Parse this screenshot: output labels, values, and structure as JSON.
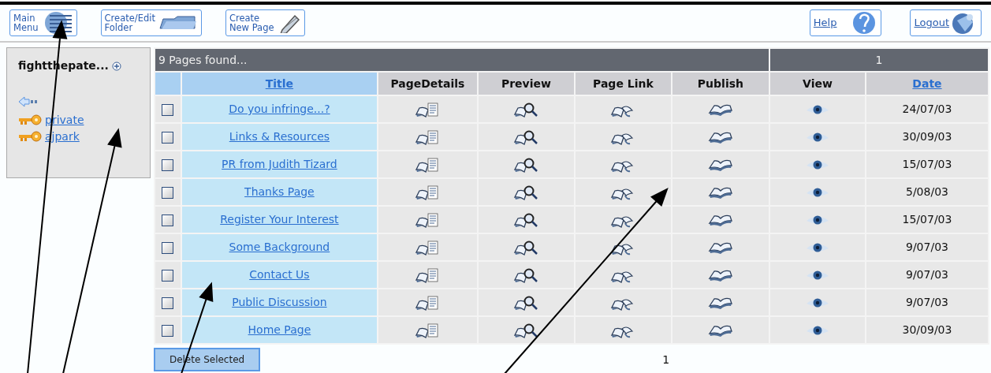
{
  "toolbar": [
    {
      "kind": "menu",
      "label_lines": [
        "Main",
        "Menu"
      ]
    },
    {
      "kind": "folder",
      "label_lines": [
        "Create/Edit",
        "Folder"
      ]
    },
    {
      "kind": "new_page",
      "label_lines": [
        "Create",
        "New Page"
      ]
    }
  ],
  "toolbar_right": [
    {
      "kind": "help",
      "label": "Help"
    },
    {
      "kind": "logout",
      "label": "Logout"
    }
  ],
  "sidebar": {
    "title": "fightthepate...",
    "items": [
      {
        "kind": "key",
        "label": "private"
      },
      {
        "kind": "key",
        "label": "ajpark"
      }
    ]
  },
  "table": {
    "summary": "9 Pages found...",
    "page_number": "1",
    "columns": [
      {
        "label": "Title",
        "sortable": true
      },
      {
        "label": "PageDetails",
        "sortable": false
      },
      {
        "label": "Preview",
        "sortable": false
      },
      {
        "label": "Page Link",
        "sortable": false
      },
      {
        "label": "Publish",
        "sortable": false
      },
      {
        "label": "View",
        "sortable": false
      },
      {
        "label": "Date",
        "sortable": true
      }
    ],
    "rows": [
      {
        "checked": false,
        "title": "Do you infringe...?",
        "date": "24/07/03"
      },
      {
        "checked": false,
        "title": "Links & Resources",
        "date": "30/09/03"
      },
      {
        "checked": false,
        "title": "PR from Judith Tizard",
        "date": "15/07/03"
      },
      {
        "checked": false,
        "title": "Thanks Page",
        "date": "5/08/03"
      },
      {
        "checked": false,
        "title": "Register Your Interest",
        "date": "15/07/03"
      },
      {
        "checked": false,
        "title": "Some Background",
        "date": "9/07/03"
      },
      {
        "checked": false,
        "title": "Contact Us",
        "date": "9/07/03"
      },
      {
        "checked": false,
        "title": "Public Discussion",
        "date": "9/07/03"
      },
      {
        "checked": false,
        "title": "Home Page",
        "date": "30/09/03"
      }
    ]
  },
  "footer": {
    "button": "Delete Selected",
    "page_number": "1"
  }
}
